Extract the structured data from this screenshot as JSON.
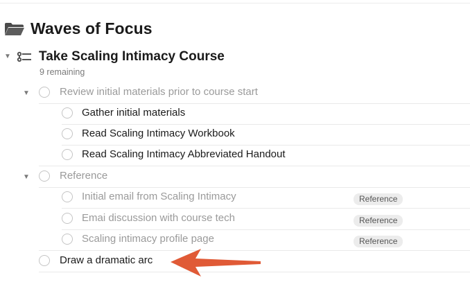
{
  "folder": {
    "title": "Waves of Focus",
    "icon": "folder-icon"
  },
  "project": {
    "title": "Take Scaling Intimacy Course",
    "remaining": "9 remaining",
    "icon": "project-outline-icon"
  },
  "groups": {
    "review": {
      "label": "Review initial materials prior to course start"
    },
    "reference": {
      "label": "Reference"
    }
  },
  "tasks": [
    {
      "label": "Gather initial materials"
    },
    {
      "label": "Read Scaling Intimacy Workbook"
    },
    {
      "label": "Read Scaling Intimacy Abbreviated Handout"
    },
    {
      "label": "Initial email from Scaling Intimacy",
      "tag": "Reference"
    },
    {
      "label": "Emai discussion with course tech",
      "tag": "Reference"
    },
    {
      "label": "Scaling intimacy profile page",
      "tag": "Reference"
    },
    {
      "label": "Draw a dramatic arc"
    }
  ],
  "colors": {
    "annotation_arrow": "#e05a36",
    "tag_bg": "#ececec"
  }
}
